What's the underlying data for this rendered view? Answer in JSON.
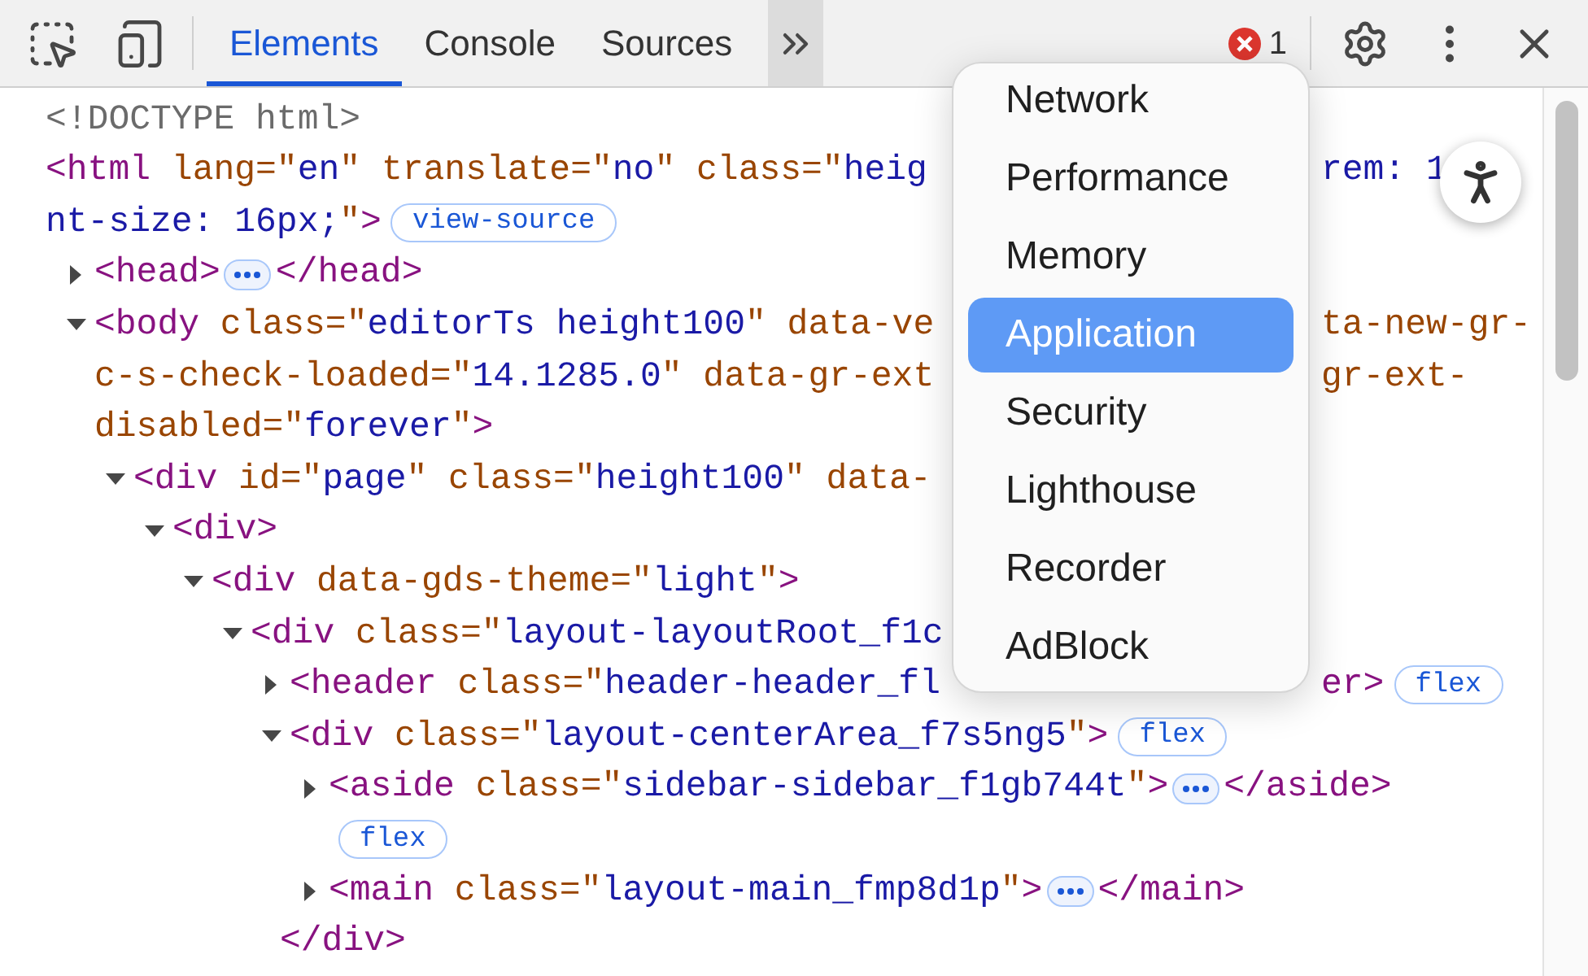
{
  "toolbar": {
    "tabs": [
      {
        "label": "Elements",
        "selected": true
      },
      {
        "label": "Console",
        "selected": false
      },
      {
        "label": "Sources",
        "selected": false
      }
    ],
    "more_tabs": {
      "expanded": true
    },
    "errors": {
      "count": "1"
    }
  },
  "dom_tree": [
    {
      "lines": [
        {
          "segs": [
            {
              "kind": "doctype",
              "t": "<!DOCTYPE html>"
            }
          ]
        }
      ]
    },
    {
      "lines": [
        {
          "segs": [
            {
              "kind": "tag",
              "t": "<html"
            },
            {
              "kind": "attr",
              "t": " lang=\""
            },
            {
              "kind": "value",
              "t": "en"
            },
            {
              "kind": "attr",
              "t": "\""
            },
            {
              "kind": "attr",
              "t": " translate=\""
            },
            {
              "kind": "value",
              "t": "no"
            },
            {
              "kind": "attr",
              "t": "\""
            },
            {
              "kind": "attr",
              "t": " class=\""
            },
            {
              "kind": "value",
              "t": "heig"
            }
          ],
          "after": [
            {
              "kind": "value",
              "t": "rem: 1"
            }
          ]
        },
        {
          "segs": [
            {
              "kind": "value",
              "t": "nt-size: 16px;"
            },
            {
              "kind": "attr",
              "t": "\""
            },
            {
              "kind": "tag",
              "t": ">"
            },
            {
              "kind": "badge",
              "t": "view-source"
            }
          ]
        }
      ],
      "children": [
        {
          "expanded": false,
          "lines": [
            {
              "segs": [
                {
                  "kind": "tag",
                  "t": "<head>"
                },
                {
                  "kind": "dots"
                },
                {
                  "kind": "tag",
                  "t": "</head>"
                }
              ]
            }
          ]
        },
        {
          "expanded": true,
          "lines": [
            {
              "segs": [
                {
                  "kind": "tag",
                  "t": "<body"
                },
                {
                  "kind": "attr",
                  "t": " class=\""
                },
                {
                  "kind": "value",
                  "t": "editorTs height100"
                },
                {
                  "kind": "attr",
                  "t": "\""
                },
                {
                  "kind": "attr",
                  "t": " data-ve"
                }
              ],
              "after": [
                {
                  "kind": "attr",
                  "t": "ta-new-gr-"
                }
              ]
            },
            {
              "segs": [
                {
                  "kind": "attr",
                  "t": "c-s-check-loaded=\""
                },
                {
                  "kind": "value",
                  "t": "14.1285.0"
                },
                {
                  "kind": "attr",
                  "t": "\""
                },
                {
                  "kind": "attr",
                  "t": " data-gr-ext"
                }
              ],
              "after": [
                {
                  "kind": "attr",
                  "t": "gr-ext-"
                }
              ]
            },
            {
              "segs": [
                {
                  "kind": "attr",
                  "t": "disabled=\""
                },
                {
                  "kind": "value",
                  "t": "forever"
                },
                {
                  "kind": "attr",
                  "t": "\""
                },
                {
                  "kind": "tag",
                  "t": ">"
                }
              ]
            }
          ],
          "children": [
            {
              "expanded": true,
              "lines": [
                {
                  "segs": [
                    {
                      "kind": "tag",
                      "t": "<div"
                    },
                    {
                      "kind": "attr",
                      "t": " id=\""
                    },
                    {
                      "kind": "value",
                      "t": "page"
                    },
                    {
                      "kind": "attr",
                      "t": "\""
                    },
                    {
                      "kind": "attr",
                      "t": " class=\""
                    },
                    {
                      "kind": "value",
                      "t": "height100"
                    },
                    {
                      "kind": "attr",
                      "t": "\""
                    },
                    {
                      "kind": "attr",
                      "t": " data-"
                    }
                  ]
                }
              ],
              "children": [
                {
                  "expanded": true,
                  "lines": [
                    {
                      "segs": [
                        {
                          "kind": "tag",
                          "t": "<div>"
                        }
                      ]
                    }
                  ],
                  "children": [
                    {
                      "expanded": true,
                      "lines": [
                        {
                          "segs": [
                            {
                              "kind": "tag",
                              "t": "<div"
                            },
                            {
                              "kind": "attr",
                              "t": " data-gds-theme=\""
                            },
                            {
                              "kind": "value",
                              "t": "light"
                            },
                            {
                              "kind": "attr",
                              "t": "\""
                            },
                            {
                              "kind": "tag",
                              "t": ">"
                            }
                          ]
                        }
                      ],
                      "children": [
                        {
                          "expanded": true,
                          "lines": [
                            {
                              "segs": [
                                {
                                  "kind": "tag",
                                  "t": "<div"
                                },
                                {
                                  "kind": "attr",
                                  "t": " class=\""
                                },
                                {
                                  "kind": "value",
                                  "t": "layout-layoutRoot_f1c"
                                }
                              ]
                            }
                          ],
                          "children": [
                            {
                              "expanded": false,
                              "lines": [
                                {
                                  "segs": [
                                    {
                                      "kind": "tag",
                                      "t": "<header"
                                    },
                                    {
                                      "kind": "attr",
                                      "t": " class=\""
                                    },
                                    {
                                      "kind": "value",
                                      "t": "header-header_fl"
                                    }
                                  ],
                                  "after": [
                                    {
                                      "kind": "tag",
                                      "t": "er>"
                                    },
                                    {
                                      "kind": "badge",
                                      "t": "flex"
                                    }
                                  ]
                                }
                              ]
                            },
                            {
                              "expanded": true,
                              "lines": [
                                {
                                  "segs": [
                                    {
                                      "kind": "tag",
                                      "t": "<div"
                                    },
                                    {
                                      "kind": "attr",
                                      "t": " class=\""
                                    },
                                    {
                                      "kind": "value",
                                      "t": "layout-centerArea_f7s5ng5"
                                    },
                                    {
                                      "kind": "attr",
                                      "t": "\""
                                    },
                                    {
                                      "kind": "tag",
                                      "t": ">"
                                    },
                                    {
                                      "kind": "badge",
                                      "t": "flex"
                                    }
                                  ]
                                }
                              ],
                              "children": [
                                {
                                  "expanded": false,
                                  "lines": [
                                    {
                                      "segs": [
                                        {
                                          "kind": "tag",
                                          "t": "<aside"
                                        },
                                        {
                                          "kind": "attr",
                                          "t": " class=\""
                                        },
                                        {
                                          "kind": "value",
                                          "t": "sidebar-sidebar_f1gb744t"
                                        },
                                        {
                                          "kind": "attr",
                                          "t": "\""
                                        },
                                        {
                                          "kind": "tag",
                                          "t": ">"
                                        },
                                        {
                                          "kind": "dots"
                                        },
                                        {
                                          "kind": "tag",
                                          "t": "</aside>"
                                        }
                                      ]
                                    },
                                    {
                                      "segs": [
                                        {
                                          "kind": "badge",
                                          "t": "flex"
                                        }
                                      ]
                                    }
                                  ]
                                },
                                {
                                  "expanded": false,
                                  "lines": [
                                    {
                                      "segs": [
                                        {
                                          "kind": "tag",
                                          "t": "<main"
                                        },
                                        {
                                          "kind": "attr",
                                          "t": " class=\""
                                        },
                                        {
                                          "kind": "value",
                                          "t": "layout-main_fmp8d1p"
                                        },
                                        {
                                          "kind": "attr",
                                          "t": "\""
                                        },
                                        {
                                          "kind": "tag",
                                          "t": ">"
                                        },
                                        {
                                          "kind": "dots"
                                        },
                                        {
                                          "kind": "tag",
                                          "t": "</main>"
                                        }
                                      ]
                                    }
                                  ]
                                }
                              ],
                              "closing": [
                                {
                                  "kind": "tag",
                                  "t": "</div>"
                                }
                              ]
                            }
                          ]
                        }
                      ]
                    }
                  ]
                }
              ]
            }
          ]
        }
      ]
    }
  ],
  "more_menu": {
    "items": [
      {
        "label": "Network",
        "selected": false
      },
      {
        "label": "Performance",
        "selected": false
      },
      {
        "label": "Memory",
        "selected": false
      },
      {
        "label": "Application",
        "selected": true
      },
      {
        "label": "Security",
        "selected": false
      },
      {
        "label": "Lighthouse",
        "selected": false
      },
      {
        "label": "Recorder",
        "selected": false
      },
      {
        "label": "AdBlock",
        "selected": false
      }
    ]
  }
}
